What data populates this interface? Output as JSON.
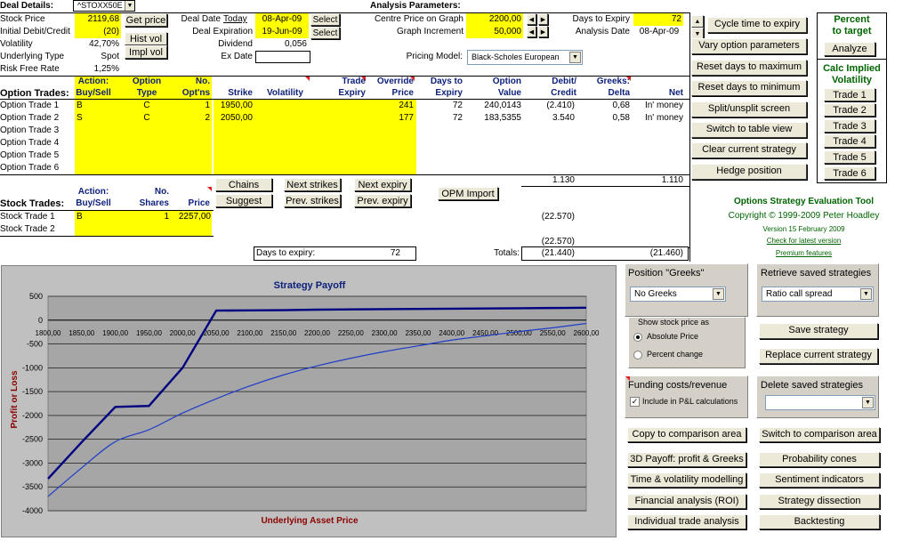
{
  "deal": {
    "title": "Deal Details:",
    "symbol": "^STOXX50E",
    "stock_price_label": "Stock Price",
    "stock_price": "2119,68",
    "get_price": "Get price",
    "initial_label": "Initial Debit/Credit",
    "initial": "(20)",
    "hist_vol": "Hist vol",
    "impl_vol": "Impl vol",
    "volatility_label": "Volatility",
    "volatility": "42,70%",
    "underlying_label": "Underlying Type",
    "underlying": "Spot",
    "rfr_label": "Risk Free Rate",
    "rfr": "1,25%",
    "deal_date_label": "Deal Date",
    "today": "Today",
    "deal_date": "08-Apr-09",
    "select": "Select",
    "deal_exp_label": "Deal Expiration",
    "deal_exp": "19-Jun-09",
    "dividend_label": "Dividend",
    "dividend": "0,056",
    "exdate_label": "Ex Date"
  },
  "analysis": {
    "title": "Analysis Parameters:",
    "centre_label": "Centre Price on Graph",
    "centre": "2200,00",
    "increment_label": "Graph Increment",
    "increment": "50,000",
    "dte_label": "Days to Expiry",
    "dte": "72",
    "adate_label": "Analysis Date",
    "adate": "08-Apr-09",
    "model_label": "Pricing Model:",
    "model": "Black-Scholes European"
  },
  "buttons_right": [
    "Cycle time to expiry",
    "Vary option parameters",
    "Reset days to maximum",
    "Reset days to minimum",
    "Split/unsplit screen",
    "Switch to table view",
    "Clear current strategy",
    "Hedge position"
  ],
  "target": {
    "title1": "Percent",
    "title2": "to target",
    "analyze": "Analyze"
  },
  "calc": {
    "title1": "Calc Implied",
    "title2": "Volatility",
    "trades": [
      "Trade 1",
      "Trade 2",
      "Trade 3",
      "Trade 4",
      "Trade 5",
      "Trade 6"
    ]
  },
  "options": {
    "section_label": "Option Trades:",
    "headers": {
      "action": "Action:",
      "buysell": "Buy/Sell",
      "option": "Option",
      "type": "Type",
      "no": "No.",
      "optns": "Opt'ns",
      "strike": "Strike",
      "volatility": "Volatility",
      "trade": "Trade",
      "expiry": "Expiry",
      "override": "Override",
      "price": "Price",
      "daysto": "Days to",
      "expiry2": "Expiry",
      "optval1": "Option",
      "optval2": "Value",
      "debit": "Debit/",
      "credit": "Credit",
      "greeks": "Greeks:",
      "delta": "Delta",
      "net": "Net"
    },
    "rows": [
      {
        "label": "Option Trade  1",
        "bs": "B",
        "type": "C",
        "no": "1",
        "strike": "1950,00",
        "override": "241",
        "days": "72",
        "value": "240,0143",
        "dc": "(2.410)",
        "delta": "0,68",
        "net": "In' money"
      },
      {
        "label": "Option Trade  2",
        "bs": "S",
        "type": "C",
        "no": "2",
        "strike": "2050,00",
        "override": "177",
        "days": "72",
        "value": "183,5355",
        "dc": "3.540",
        "delta": "0,58",
        "net": "In' money"
      },
      {
        "label": "Option Trade  3",
        "bs": "",
        "type": "",
        "no": "",
        "strike": "",
        "override": "",
        "days": "",
        "value": "",
        "dc": "",
        "delta": "",
        "net": ""
      },
      {
        "label": "Option Trade  4",
        "bs": "",
        "type": "",
        "no": "",
        "strike": "",
        "override": "",
        "days": "",
        "value": "",
        "dc": "",
        "delta": "",
        "net": ""
      },
      {
        "label": "Option Trade  5",
        "bs": "",
        "type": "",
        "no": "",
        "strike": "",
        "override": "",
        "days": "",
        "value": "",
        "dc": "",
        "delta": "",
        "net": ""
      },
      {
        "label": "Option Trade  6",
        "bs": "",
        "type": "",
        "no": "",
        "strike": "",
        "override": "",
        "days": "",
        "value": "",
        "dc": "",
        "delta": "",
        "net": ""
      }
    ],
    "total_dc": "1.130",
    "total_net": "1.110"
  },
  "mid_buttons": {
    "chains": "Chains",
    "suggest": "Suggest",
    "next_strikes": "Next strikes",
    "prev_strikes": "Prev. strikes",
    "next_expiry": "Next expiry",
    "prev_expiry": "Prev. expiry",
    "opm_import": "OPM Import"
  },
  "stock": {
    "section_label": "Stock Trades:",
    "action": "Action:",
    "buysell": "Buy/Sell",
    "no": "No.",
    "shares": "Shares",
    "price_h": "Price",
    "rows": [
      {
        "label": "Stock Trade 1",
        "bs": "B",
        "shares": "1",
        "price": "2257,00",
        "dc": "(22.570)"
      },
      {
        "label": "Stock Trade 2",
        "bs": "",
        "shares": "",
        "price": "",
        "dc": ""
      }
    ],
    "subtotal": "(22.570)",
    "days_label": "Days to expiry:",
    "days": "72",
    "totals_label": "Totals:",
    "total_dc": "(21.440)",
    "total_net": "(21.460)"
  },
  "credits": {
    "title": "Options Strategy Evaluation Tool",
    "copyright": "Copyright © 1999-2009 Peter Hoadley",
    "version": "Version 15 February 2009",
    "check": "Check for latest version",
    "premium": "Premium features"
  },
  "panels": {
    "greeks_label": "Position \"Greeks\"",
    "greeks_value": "No Greeks",
    "retrieve_label": "Retrieve saved strategies",
    "retrieve_value": "Ratio call spread",
    "show_price_label": "Show stock price as",
    "absolute": "Absolute Price",
    "percent": "Percent change",
    "save": "Save strategy",
    "replace": "Replace current strategy",
    "funding_label": "Funding costs/revenue",
    "funding_check": "Include in P&L calculations",
    "delete_label": "Delete saved strategies",
    "copy_cmp": "Copy to comparison area",
    "switch_cmp": "Switch to comparison area",
    "b3d": "3D Payoff: profit & Greeks",
    "prob": "Probability cones",
    "timevol": "Time & volatility modelling",
    "sentiment": "Sentiment indicators",
    "roi": "Financial analysis (ROI)",
    "dissect": "Strategy dissection",
    "indiv": "Individual trade analysis",
    "backtest": "Backtesting"
  },
  "colors": {
    "chart_bg": "#c0c0c0",
    "series_expiry": "#000080",
    "series_now": "#1e3cc8",
    "title": "#0b1f7a",
    "axis_label": "#8b0000"
  },
  "chart_data": {
    "type": "line",
    "title": "Strategy Payoff",
    "xlabel": "Underlying Asset Price",
    "ylabel": "Profit or Loss",
    "x": [
      1800,
      1850,
      1900,
      1950,
      2000,
      2050,
      2100,
      2150,
      2200,
      2250,
      2300,
      2350,
      2400,
      2450,
      2500,
      2550,
      2600
    ],
    "x_ticks": [
      "1800,00",
      "1850,00",
      "1900,00",
      "1950,00",
      "2000,00",
      "2050,00",
      "2100,00",
      "2150,00",
      "2200,00",
      "2250,00",
      "2300,00",
      "2350,00",
      "2400,00",
      "2450,00",
      "2500,00",
      "2550,00",
      "2600,00"
    ],
    "ylim": [
      -4000,
      500
    ],
    "y_ticks": [
      500,
      0,
      -500,
      -1000,
      -1500,
      -2000,
      -2500,
      -3000,
      -3500,
      -4000
    ],
    "grid": true,
    "series": [
      {
        "values": [
          -3330,
          -2560,
          -1820,
          -1800,
          -1000,
          200,
          205,
          210,
          220,
          225,
          230,
          235,
          240,
          245,
          250,
          255,
          260
        ]
      },
      {
        "values": [
          -3700,
          -3100,
          -2550,
          -2300,
          -1950,
          -1650,
          -1380,
          -1150,
          -960,
          -800,
          -660,
          -540,
          -420,
          -330,
          -240,
          -160,
          -70
        ]
      }
    ]
  }
}
